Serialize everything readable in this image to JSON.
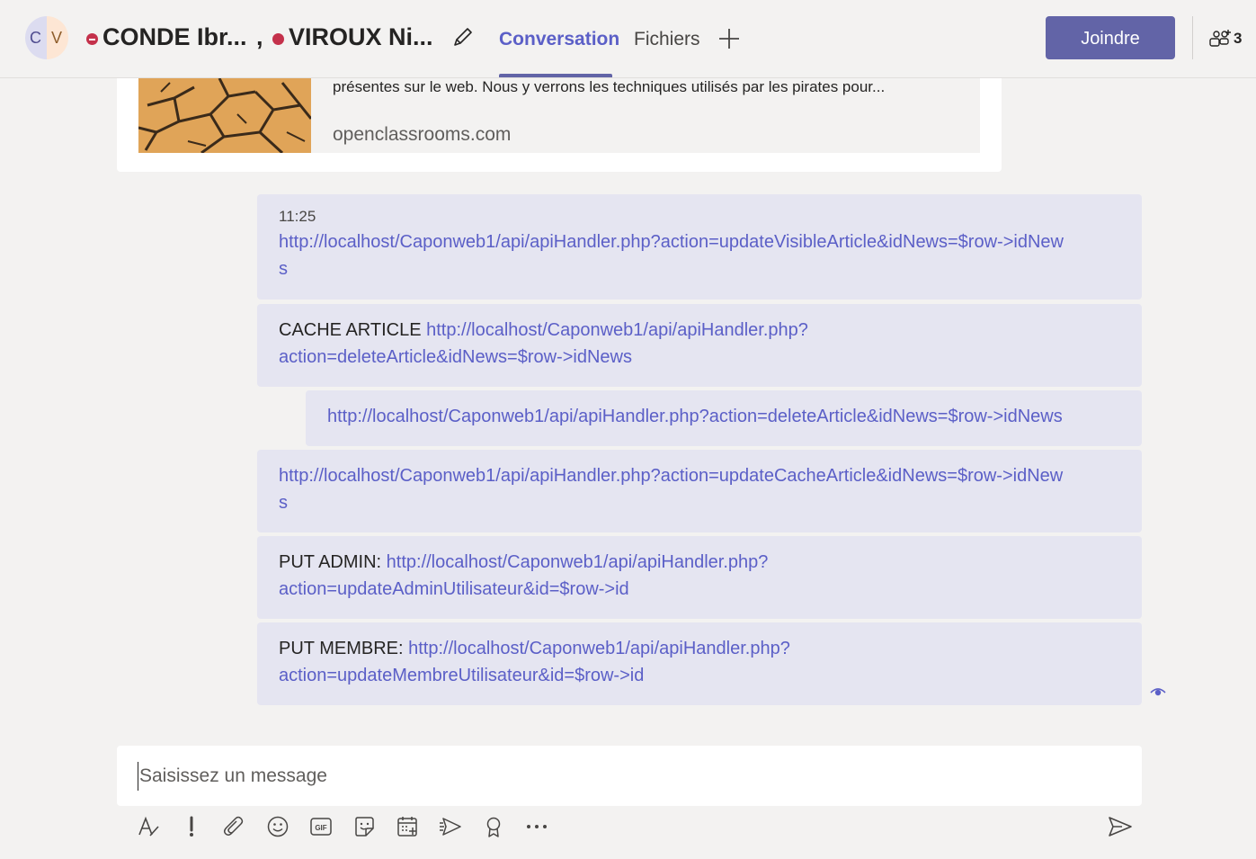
{
  "header": {
    "avatar_letters": [
      "C",
      "V"
    ],
    "participant_1": "CONDE Ibr...",
    "separator": ",",
    "participant_2": "VIROUX Ni...",
    "edit_icon": "pencil-icon",
    "tabs": [
      {
        "label": "Conversation",
        "active": true
      },
      {
        "label": "Fichiers",
        "active": false
      }
    ],
    "add_tab_icon": "plus-icon",
    "join_label": "Joindre",
    "participants_icon": "people-add-icon",
    "participants_count": "3",
    "status_color": "#c4314b",
    "accent_color": "#6264a7"
  },
  "preview": {
    "description": "présentes sur le web. Nous y verrons les techniques utilisés par les pirates pour...",
    "domain": "openclassrooms.com"
  },
  "messages": [
    {
      "time": "11:25",
      "prefix": "",
      "link": "http://localhost/Caponweb1/api/apiHandler.php?action=updateVisibleArticle&idNews=$row->idNews"
    },
    {
      "prefix": "CACHE ARTICLE ",
      "link": "http://localhost/Caponweb1/api/apiHandler.php?action=deleteArticle&idNews=$row->idNews"
    },
    {
      "prefix": "",
      "link": "http://localhost/Caponweb1/api/apiHandler.php?action=deleteArticle&idNews=$row->idNews"
    },
    {
      "prefix": "",
      "link": "http://localhost/Caponweb1/api/apiHandler.php?action=updateCacheArticle&idNews=$row->idNews"
    },
    {
      "prefix": "PUT ADMIN: ",
      "link": "http://localhost/Caponweb1/api/apiHandler.php?action=updateAdminUtilisateur&id=$row->id"
    },
    {
      "prefix": "PUT MEMBRE: ",
      "link": "http://localhost/Caponweb1/api/apiHandler.php?action=updateMembreUtilisateur&id=$row->id"
    }
  ],
  "compose": {
    "placeholder": "Saisissez un message",
    "tools": [
      "format-icon",
      "important-icon",
      "attach-icon",
      "emoji-icon",
      "gif-icon",
      "sticker-icon",
      "schedule-meeting-icon",
      "stream-icon",
      "praise-icon",
      "more-icon"
    ],
    "send_icon": "send-icon"
  }
}
